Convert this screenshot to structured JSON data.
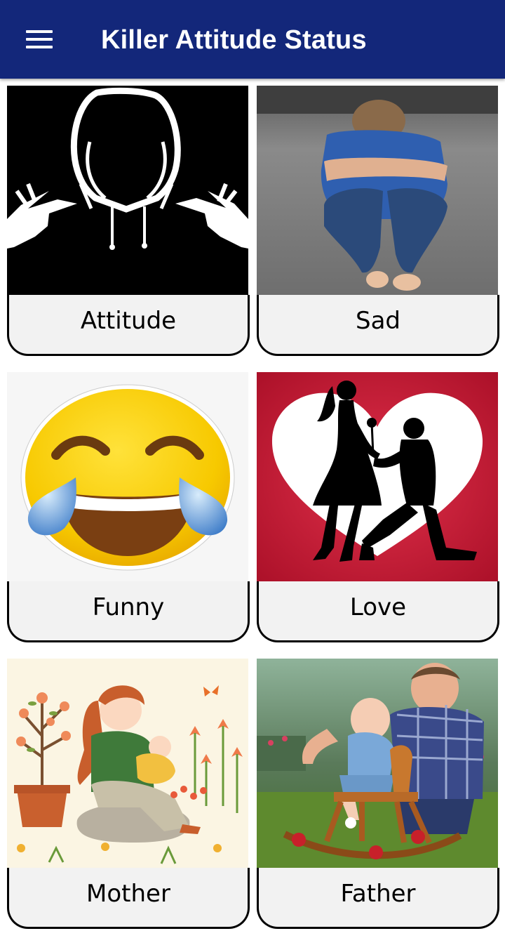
{
  "appbar": {
    "title": "Killer Attitude Status",
    "menu_icon": "hamburger-menu-icon",
    "background": "#13277a"
  },
  "categories": [
    {
      "label": "Attitude",
      "image": "hooded-figure-peace-signs"
    },
    {
      "label": "Sad",
      "image": "sad-boy-sitting"
    },
    {
      "label": "Funny",
      "image": "laughing-crying-emoji"
    },
    {
      "label": "Love",
      "image": "couple-silhouette-heart"
    },
    {
      "label": "Mother",
      "image": "mother-with-baby-illustration"
    },
    {
      "label": "Father",
      "image": "father-with-child-rocking-horse"
    }
  ]
}
